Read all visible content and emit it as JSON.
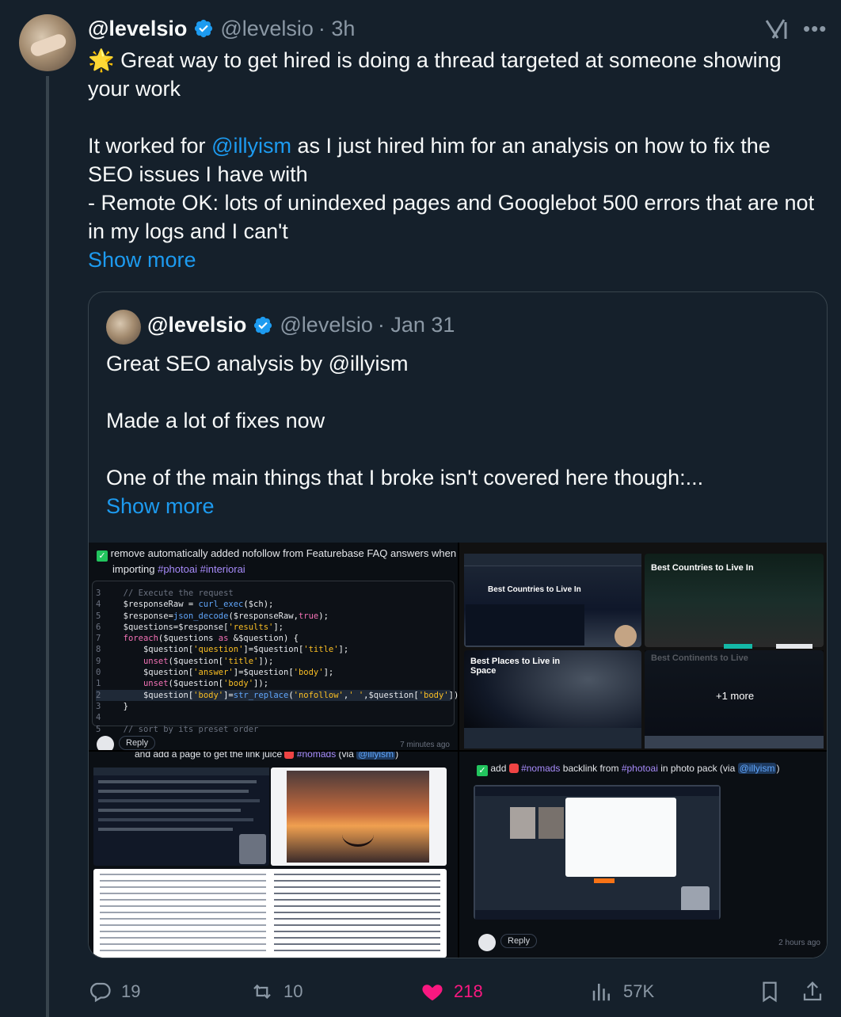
{
  "tweet": {
    "name": "@levelsio",
    "handle": "@levelsio",
    "time": "· 3h",
    "line1": "🌟 Great way to get hired is doing a thread targeted at someone showing your work",
    "line2_prefix": "It worked for ",
    "line2_mention": "@illyism",
    "line2_suffix": " as I just hired him for an analysis on how to fix the SEO issues I have with",
    "line3": "- Remote OK: lots of unindexed pages and Googlebot 500 errors that are not in my logs and I can't",
    "show_more": "Show more"
  },
  "quote": {
    "name": "@levelsio",
    "handle": "@levelsio",
    "time": "· Jan 31",
    "line1": "Great SEO analysis by @illyism",
    "line2": "Made a lot of fixes now",
    "line3": "One of the main things that I broke isn't covered here though:...",
    "show_more": "Show more"
  },
  "images": {
    "top_left_task": "remove automatically added nofollow from Featurebase FAQ answers when",
    "top_left_task2": "importing",
    "tag_photoai": "#photoai",
    "tag_interiorai": "#interiorai",
    "code_comment": "// Execute the request",
    "code_sort": "// sort by its preset order",
    "reply": "Reply",
    "minutes_ago": "7 minutes ago",
    "countries_title": "Best Countries to Live In",
    "places_title": "Best Places to Live in Space",
    "continents_title": "Best Continents to Live",
    "plus_more": "+1 more",
    "nomads_caption": "and add a page to get the link juice",
    "nomads_tag": "#nomads",
    "via": "(via",
    "illyism": "@illyism",
    "close_paren": ")",
    "bottom_right_add": "add",
    "bottom_right_mid": "backlink from",
    "bottom_right_end": "in photo pack (via",
    "hours_ago": "2 hours ago"
  },
  "actions": {
    "replies": "19",
    "reposts": "10",
    "likes": "218",
    "views": "57K"
  },
  "colors": {
    "background": "#15202b",
    "accent": "#1d9bf0",
    "like": "#f91880",
    "muted": "#8b98a5"
  }
}
